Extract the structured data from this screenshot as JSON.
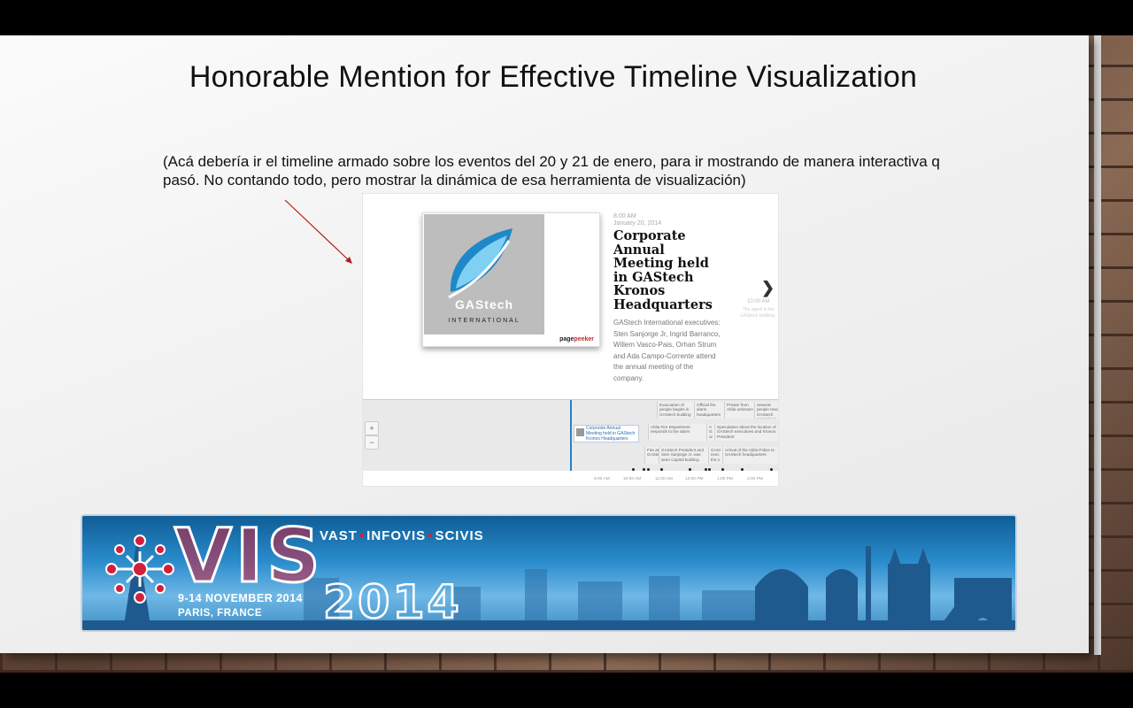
{
  "slide": {
    "title": "Honorable Mention for Effective Timeline Visualization",
    "note": "(Acá debería ir el timeline armado sobre los eventos del 20 y 21 de enero, para ir mostrando de manera interactiva q pasó. No contando todo, pero mostrar la dinámica de esa herramienta de visualización)"
  },
  "screenshot": {
    "logo_word": "GAStech",
    "logo_sub": "INTERNATIONAL",
    "pagepeeker_a": "page",
    "pagepeeker_b": "peeker",
    "event": {
      "time": "8:00 AM",
      "date": "January 20, 2014",
      "title": "Corporate Annual Meeting held in GAStech Kronos Headquarters",
      "description": "GAStech International executives: Sten Sanjorge Jr, Ingrid Barranco, Willem Vasco-Pais, Orhan Strum and Ada Campo-Corrente attend the annual meeting of the company."
    },
    "next_arrow": "❯",
    "next_time": "10:00 AM",
    "next_desc": "The agent in the GAStech building",
    "zoom_in": "+",
    "zoom_out": "−",
    "timeline": {
      "active_card": "Corporate Annual Meeting held in GAStech Kronos Headquarters",
      "cards": [
        "Evacuation of people begins in GAStech building",
        "Official fire alarm headquarters",
        "Private from Abila unknown",
        "Several people reach GAStech executives",
        "Abila Fire Department responds to the alarm",
        "A G ur",
        "Speculation about the location of GAStech executives and Kronos President",
        "Fire at GAStech",
        "GAStech President and Sten Sanjorge Jr. was seen Capitol building",
        "GASI exec the s",
        "Arrival of the Abila Police to GAStech headquarters"
      ],
      "ticks": [
        "9:00 AM",
        "10:00 AM",
        "11:00 AM",
        "12:00 PM",
        "1:00 PM",
        "2:00 PM"
      ]
    }
  },
  "banner": {
    "logo": "VIS",
    "year": "2014",
    "conferences": [
      "VAST",
      "INFOVIS",
      "SCIVIS"
    ],
    "dates": "9-14 NOVEMBER 2014",
    "city": "PARIS, FRANCE"
  },
  "colors": {
    "slide_bg": "#f2f2f2",
    "accent_red": "#a11212",
    "timeline_blue": "#2b7fc8",
    "banner_blue": "#2a8ccc",
    "vis_red": "#d21f3c"
  }
}
